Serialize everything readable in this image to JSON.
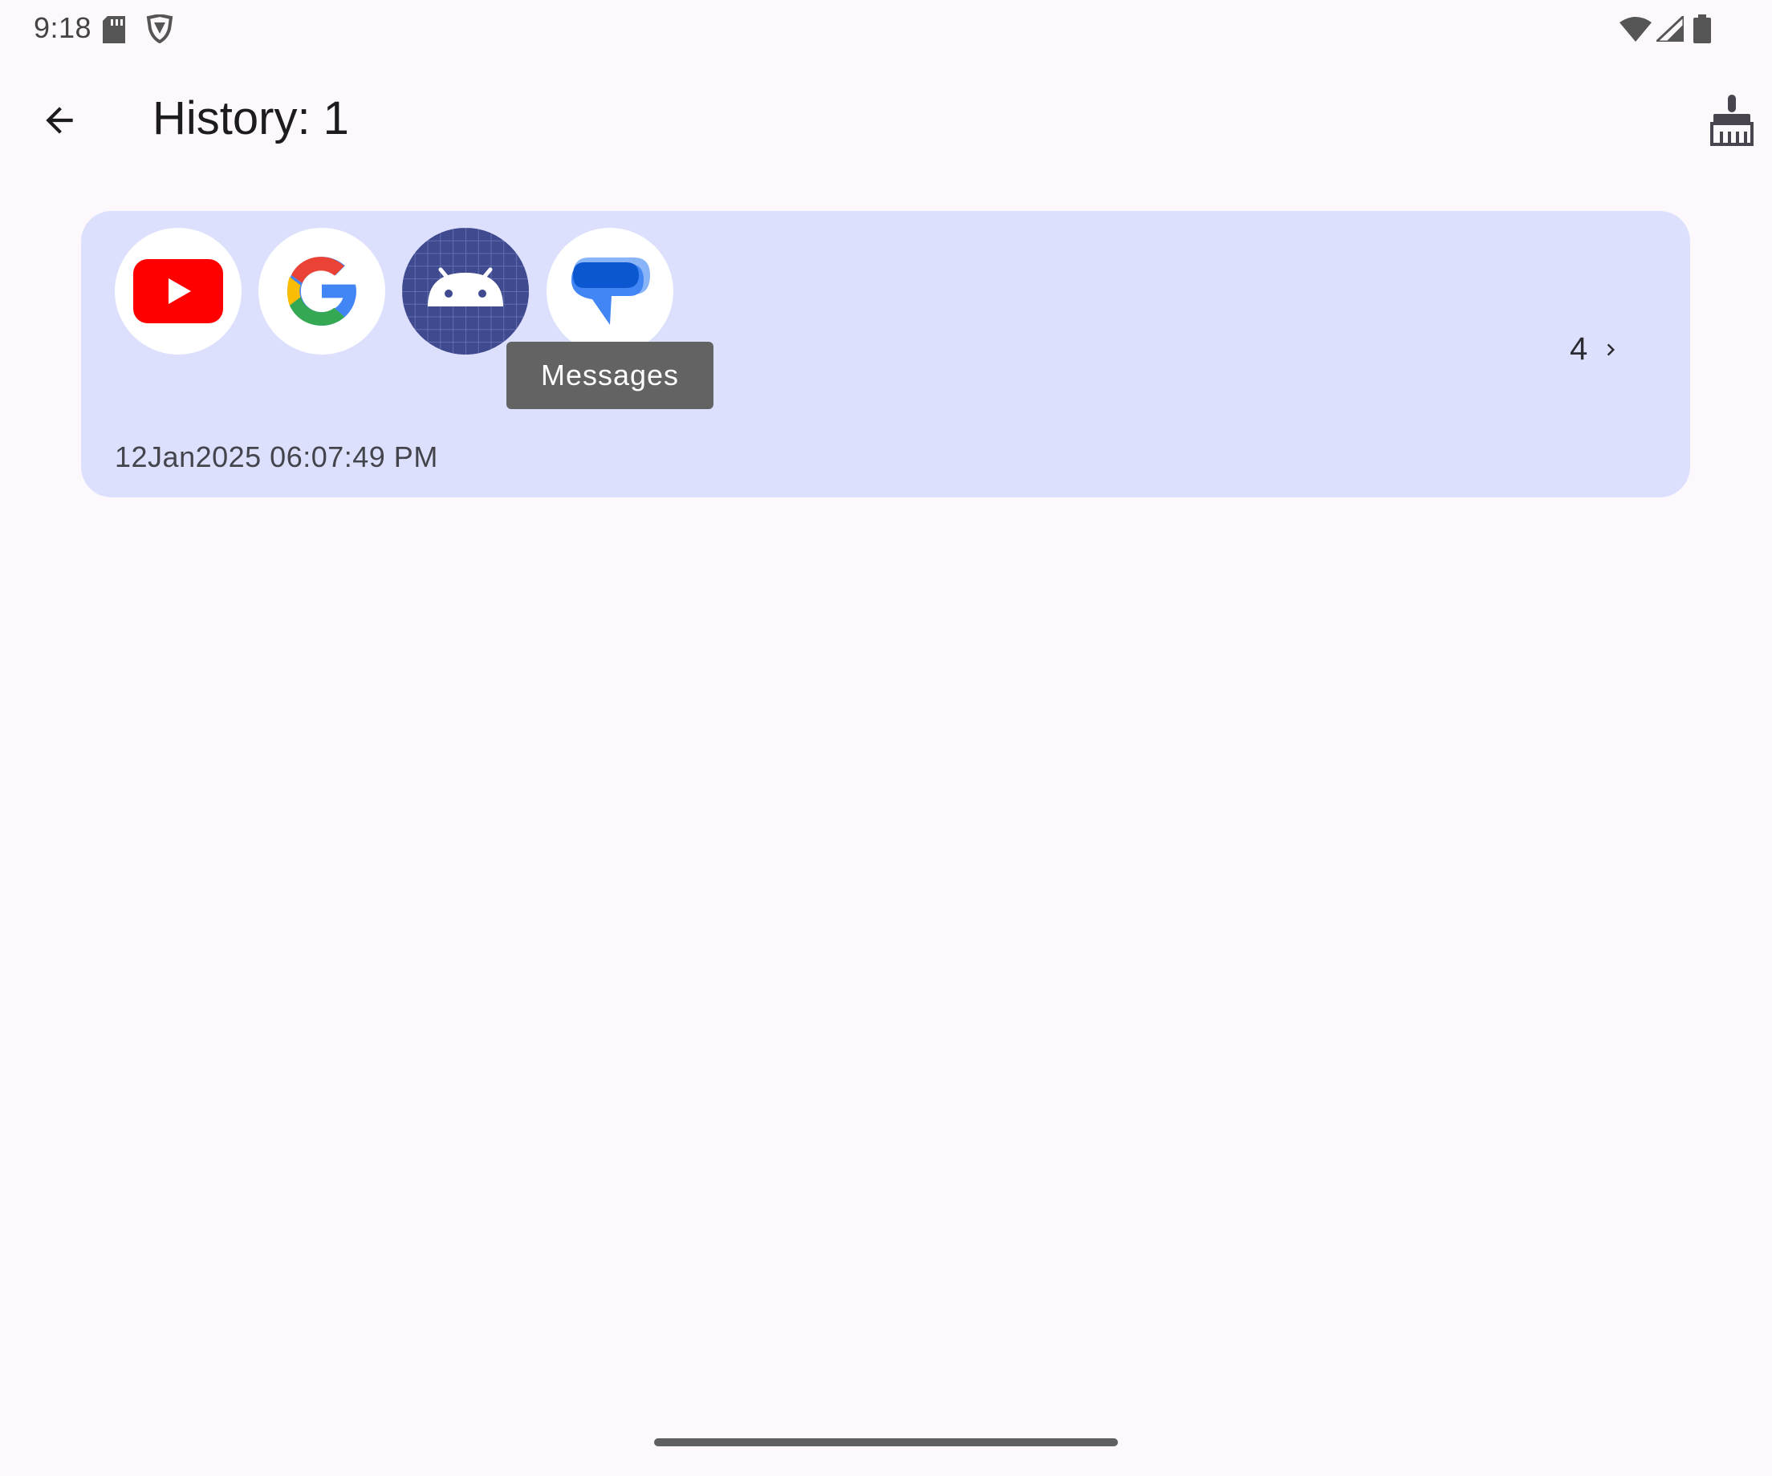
{
  "status_bar": {
    "time": "9:18",
    "icons": [
      "sd-card-icon",
      "vpn-shield-icon",
      "wifi-icon",
      "cell-signal-icon",
      "battery-icon"
    ]
  },
  "app_bar": {
    "title": "History: 1",
    "back_icon": "arrow-back-icon",
    "clear_icon": "broom-icon"
  },
  "history": {
    "items": [
      {
        "apps": [
          {
            "name": "YouTube",
            "icon": "youtube-icon"
          },
          {
            "name": "Google",
            "icon": "google-icon"
          },
          {
            "name": "Android",
            "icon": "android-icon"
          },
          {
            "name": "Messages",
            "icon": "messages-icon"
          }
        ],
        "tooltip": "Messages",
        "count": "4",
        "timestamp": "12Jan2025 06:07:49 PM",
        "background_color": "#dde0fd"
      }
    ]
  },
  "colors": {
    "background": "#fdf8fc",
    "card": "#dde0fd",
    "tooltip": "#636363",
    "youtube_red": "#ff0000",
    "android_bg": "#3f4a8f",
    "messages_blue": "#0b57d0"
  }
}
